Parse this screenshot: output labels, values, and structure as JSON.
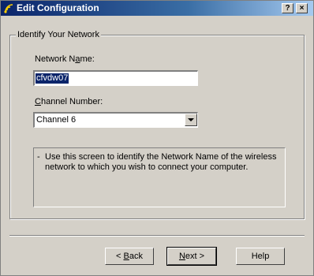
{
  "window": {
    "title": "Edit Configuration",
    "help_button": "?",
    "close_button": "×"
  },
  "group": {
    "legend": "Identify Your Network",
    "network_name_label_pre": "Network N",
    "network_name_label_mn": "a",
    "network_name_label_post": "me:",
    "network_name_value": "cfvdw07",
    "channel_label_mn": "C",
    "channel_label_post": "hannel Number:",
    "channel_selected": "Channel 6",
    "info_bullet": "-",
    "info_text": "Use this screen to identify the Network Name of the wireless network to which you wish to connect your computer."
  },
  "buttons": {
    "back_arrow": "<",
    "back_mn": "B",
    "back_rest": "ack",
    "next_mn": "N",
    "next_rest": "ext",
    "next_arrow": ">",
    "help": "Help"
  }
}
